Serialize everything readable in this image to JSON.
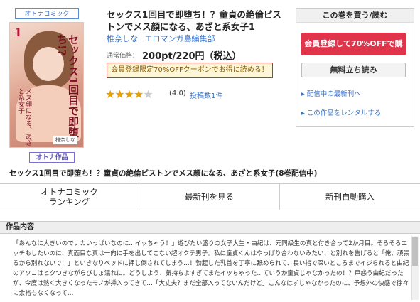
{
  "badge": {
    "category": "オトナコミック",
    "type": "オトナ作品"
  },
  "cover": {
    "volume": "1",
    "vertical_title": "セックス1回目で即堕ち!?",
    "vertical_sub": "メス顔になる、あざと系女子",
    "author_tag": "椎奈しな"
  },
  "book": {
    "title": "セックス1回目で即堕ち！？童貞の絶倫ピストンでメス顔になる、あざと系女子1",
    "authors": [
      "椎奈しな",
      "エロマンガ島編集部"
    ],
    "price_label": "通常価格：",
    "price": "200pt/220円（税込）",
    "promo": "会員登録限定70%OFFクーポンでお得に読める！",
    "rating_value": 4.0,
    "rating_text": "(4.0)",
    "review_link": "投稿数1件"
  },
  "buy": {
    "header": "この巻を買う/読む",
    "register_button": "会員登録して70%OFFで購入",
    "free_button": "無料立ち読み",
    "links": [
      "配信中の最新刊へ",
      "この作品をレンタルする"
    ]
  },
  "series_line": "セックス1回目で即堕ち！？童貞の絶倫ピストンでメス顔になる、あざと系女子(8巻配信中)",
  "tabs": [
    {
      "label": "オトナコミック\nランキング"
    },
    {
      "label": "最新刊を見る"
    },
    {
      "label": "新刊自動購入"
    }
  ],
  "content": {
    "heading": "作品内容",
    "description": "「あんなに大きいのでナカいっぱいなのに…イッちゃう！」遊びたい盛りの女子大生・由紀は、元同級生の真と付き合って2か月目。そろそろエッチもしたいのに、真面目な真は一向に手を出してこない超オクテ男子。私に童貞くんはやっぱり合わないみたい、と別れを告げると「俺、頑張るから別れないで！」といきなりベッドに押し倒されてしまう…！勃起した乳首を丁寧に舐められて、長い指で深いところまでイジられると由紀のアソコはヒクつきながらびしょ濡れに。どうしよう、気持ちよすぎてまたイッちゃった…ていうか童貞じゃなかったの！？戸惑う由紀だったが、今度は熱く大きくなったモノが挿入ってきて…「大丈夫？まだ全部入ってないんだけど」こんなはずじゃなかったのに、予想外の快感で徐々に余裕もなくなって…"
  }
}
